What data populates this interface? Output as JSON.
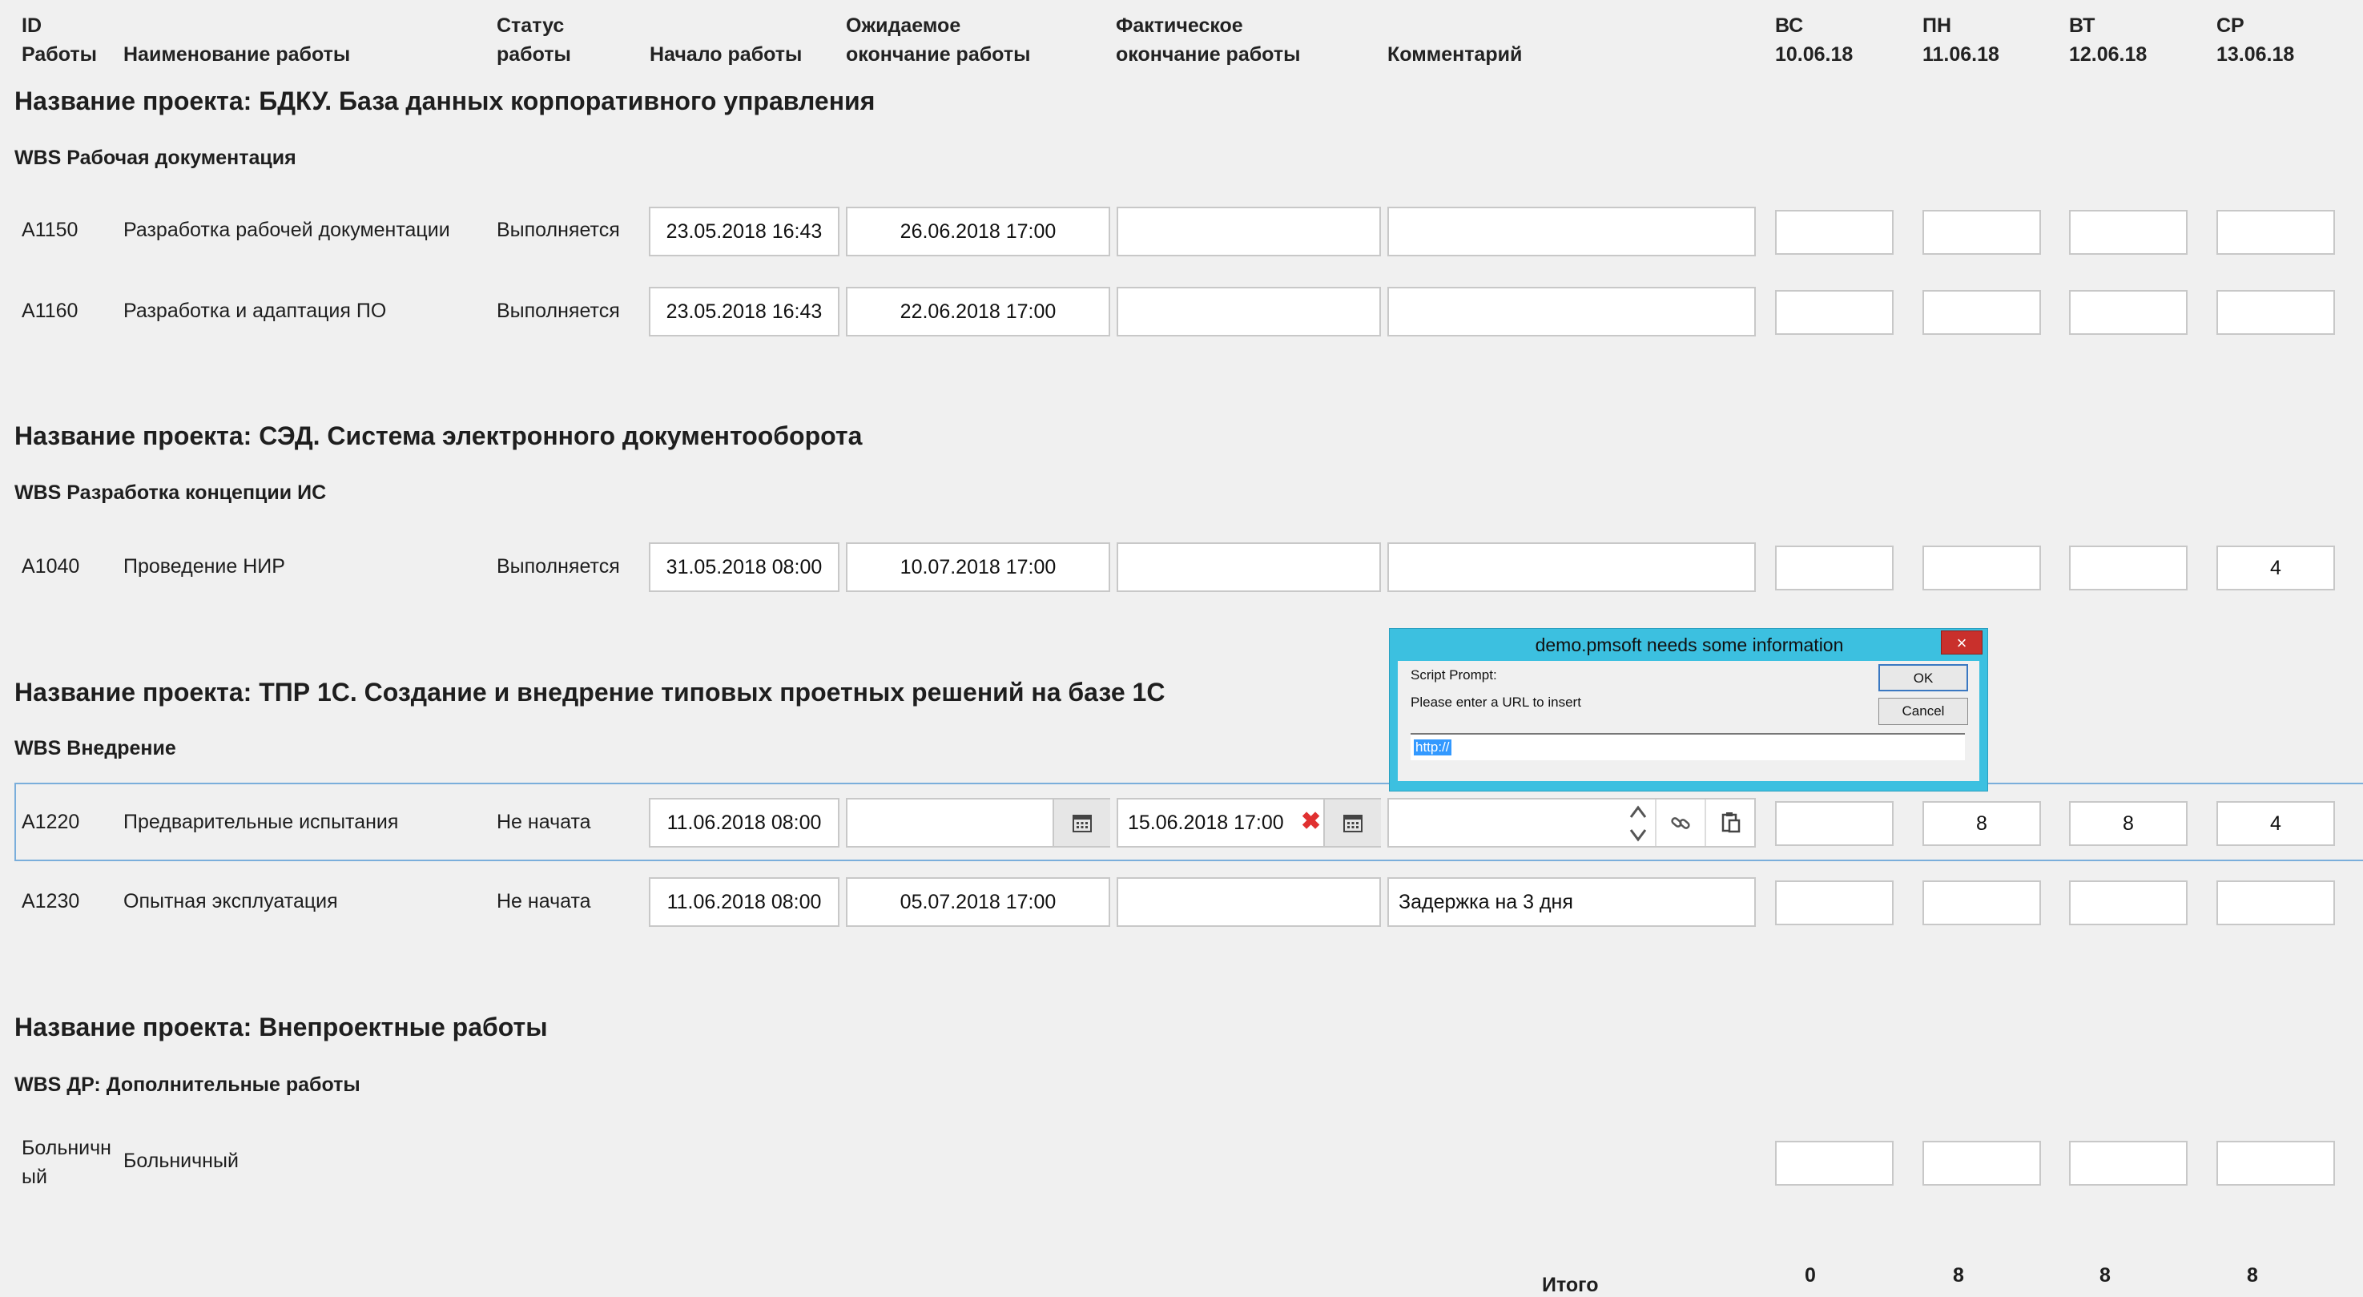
{
  "header": {
    "id": [
      "ID",
      "Работы"
    ],
    "name": [
      "",
      "Наименование работы"
    ],
    "status": [
      "Статус",
      "работы"
    ],
    "start": [
      "",
      "Начало работы"
    ],
    "expected": [
      "Ожидаемое",
      "окончание работы"
    ],
    "actual": [
      "Фактическое",
      "окончание работы"
    ],
    "comment": [
      "",
      "Комментарий"
    ],
    "days": [
      {
        "dow": "ВС",
        "date": "10.06.18"
      },
      {
        "dow": "ПН",
        "date": "11.06.18"
      },
      {
        "dow": "ВТ",
        "date": "12.06.18"
      },
      {
        "dow": "СР",
        "date": "13.06.18"
      }
    ]
  },
  "projects": [
    {
      "title": "Название проекта: БДКУ. База данных корпоративного управления",
      "wbs": "WBS Рабочая документация"
    },
    {
      "title": "Название проекта: СЭД. Система электронного документооборота",
      "wbs": "WBS Разработка концепции ИС"
    },
    {
      "title": "Название проекта: ТПР 1С. Создание и внедрение типовых проетных решений на базе 1С",
      "wbs": "WBS Внедрение"
    },
    {
      "title": "Название проекта: Внепроектные работы",
      "wbs": "WBS ДР: Дополнительные работы"
    }
  ],
  "rows": {
    "a1150": {
      "id": "A1150",
      "name": "Разработка рабочей документации",
      "status": "Выполняется",
      "start": "23.05.2018 16:43",
      "expected": "26.06.2018 17:00",
      "actual": "",
      "comment": "",
      "hours": [
        "",
        "",
        "",
        ""
      ]
    },
    "a1160": {
      "id": "A1160",
      "name": "Разработка и адаптация ПО",
      "status": "Выполняется",
      "start": "23.05.2018 16:43",
      "expected": "22.06.2018 17:00",
      "actual": "",
      "comment": "",
      "hours": [
        "",
        "",
        "",
        ""
      ]
    },
    "a1040": {
      "id": "A1040",
      "name": "Проведение НИР",
      "status": "Выполняется",
      "start": "31.05.2018 08:00",
      "expected": "10.07.2018 17:00",
      "actual": "",
      "comment": "",
      "hours": [
        "",
        "",
        "",
        "4"
      ]
    },
    "a1220": {
      "id": "A1220",
      "name": "Предварительные испытания",
      "status": "Не начата",
      "start": "11.06.2018 08:00",
      "expected": "",
      "actual": "15.06.2018 17:00",
      "comment": "",
      "hours": [
        "",
        "8",
        "8",
        "4"
      ]
    },
    "a1230": {
      "id": "A1230",
      "name": "Опытная эксплуатация",
      "status": "Не начата",
      "start": "11.06.2018 08:00",
      "expected": "05.07.2018 17:00",
      "actual": "",
      "comment": "Задержка на 3 дня",
      "hours": [
        "",
        "",
        "",
        ""
      ]
    },
    "sick": {
      "id": [
        "Больничн",
        "ый"
      ],
      "name": "Больничный",
      "hours": [
        "",
        "",
        "",
        ""
      ]
    }
  },
  "totals": {
    "label": "Итого",
    "values": [
      "0",
      "8",
      "8",
      "8"
    ]
  },
  "dialog": {
    "title": "demo.pmsoft needs some information",
    "close": "×",
    "prompt_label": "Script Prompt:",
    "message": "Please enter a URL to insert",
    "ok": "OK",
    "cancel": "Cancel",
    "input_value": "http://"
  },
  "icons": {
    "calendar": "calendar-icon",
    "clear": "clear-icon",
    "link": "link-icon",
    "clipboard": "clipboard-icon",
    "spinner": "spinner-icon"
  }
}
